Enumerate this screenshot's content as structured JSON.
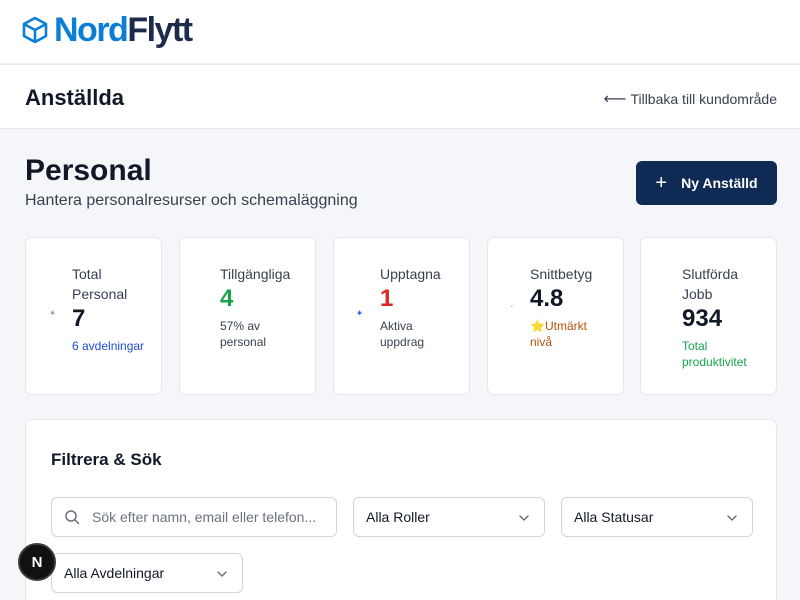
{
  "brand": {
    "name_part1": "Nord",
    "name_part2": "Flytt"
  },
  "page_header": {
    "title": "Anställda",
    "back_link": "Tillbaka till kundområde",
    "back_arrow": "⟵"
  },
  "main": {
    "title": "Personal",
    "subtitle": "Hantera personalresurser och schemaläggning",
    "new_button": "Ny Anställd"
  },
  "stats": [
    {
      "label": "Total Personal",
      "value": "7",
      "note": "6 avdelningar",
      "note_color": "#1d4ed8"
    },
    {
      "label": "Tillgängliga",
      "value": "4",
      "value_color": "#16a34a",
      "note": "57% av personal"
    },
    {
      "label": "Upptagna",
      "value": "1",
      "value_color": "#dc2626",
      "note": "Aktiva uppdrag"
    },
    {
      "label": "Snittbetyg",
      "value": "4.8",
      "note_prefix": "⭐",
      "note": "Utmärkt nivå",
      "note_color": "#b45309"
    },
    {
      "label": "Slutförda Jobb",
      "value": "934",
      "note": "Total produktivitet",
      "note_color": "#16a34a"
    }
  ],
  "filters": {
    "title": "Filtrera & Sök",
    "search_placeholder": "Sök efter namn, email eller telefon...",
    "role_select": "Alla Roller",
    "status_select": "Alla Statusar",
    "department_select": "Alla Avdelningar"
  },
  "dev_badge": "N",
  "colors": {
    "brand_blue": "#0a7fd6",
    "brand_navy": "#1c2b4b",
    "primary_button": "#0e2a55"
  }
}
